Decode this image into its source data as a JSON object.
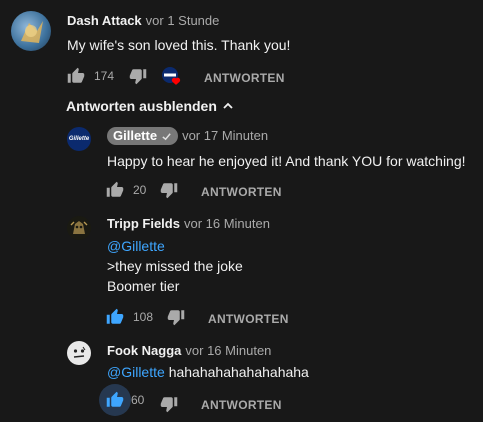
{
  "comments": [
    {
      "author": "Dash Attack",
      "time": "vor 1 Stunde",
      "text": "My wife's son loved this. Thank you!",
      "likes": "174",
      "reply_label": "ANTWORTEN"
    }
  ],
  "hide_replies_label": "Antworten ausblenden",
  "replies": [
    {
      "author": "Gillette",
      "time": "vor 17 Minuten",
      "verified": true,
      "avatar_text": "Gillette",
      "text": "Happy to hear he enjoyed it! And thank YOU for watching!",
      "likes": "20",
      "reply_label": "ANTWORTEN"
    },
    {
      "author": "Tripp Fields",
      "time": "vor 16 Minuten",
      "lines": [
        "@Gillette",
        ">they missed the joke",
        "Boomer tier"
      ],
      "likes": "108",
      "reply_label": "ANTWORTEN"
    },
    {
      "author": "Fook Nagga",
      "time": "vor 16 Minuten",
      "mention": "@Gillette",
      "text": "hahahahahahahahaha",
      "likes": "60",
      "reply_label": "ANTWORTEN"
    }
  ],
  "colors": {
    "background": "#181818",
    "link": "#3ea6ff",
    "muted": "#aaaaaa",
    "creator_heart": "#ff0000"
  }
}
